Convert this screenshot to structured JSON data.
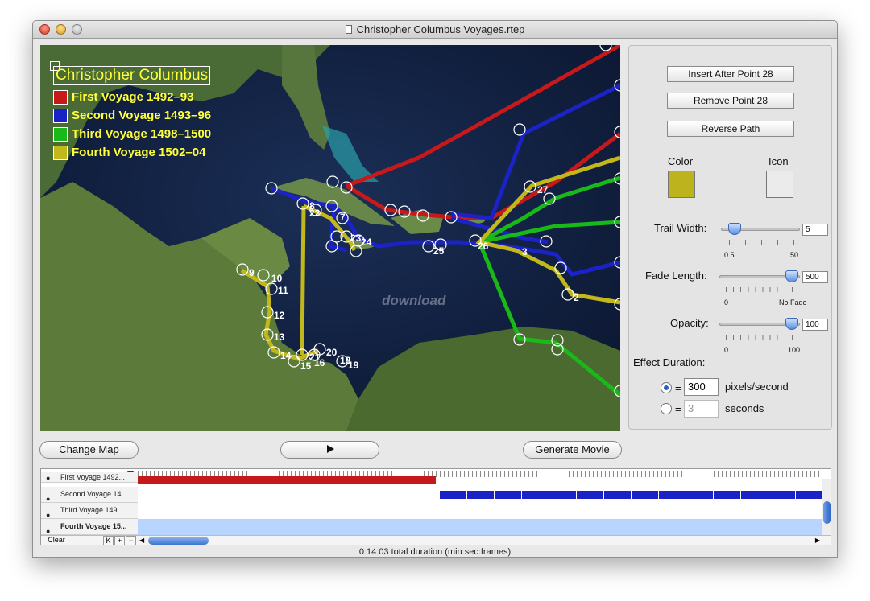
{
  "window": {
    "title": "Christopher Columbus Voyages.rtep"
  },
  "map": {
    "legend_title": "Christopher Columbus",
    "voyages": [
      {
        "label": "First Voyage 1492–93",
        "color": "#c8191a"
      },
      {
        "label": "Second Voyage 1493–96",
        "color": "#1a22c8"
      },
      {
        "label": "Third Voyage 1498–1500",
        "color": "#18b918"
      },
      {
        "label": "Fourth Voyage 1502–04",
        "color": "#c2b81c"
      }
    ],
    "point_labels": [
      "27",
      "8",
      "22",
      "7",
      "23",
      "24",
      "25",
      "26",
      "3",
      "2",
      "9",
      "10",
      "11",
      "12",
      "13",
      "14",
      "15",
      "21",
      "16",
      "20",
      "18",
      "19"
    ],
    "watermark": "download"
  },
  "panel": {
    "insert_button": "Insert After Point 28",
    "remove_button": "Remove Point 28",
    "reverse_button": "Reverse Path",
    "color_label": "Color",
    "icon_label": "Icon",
    "selected_color": "#bdb31c",
    "trail_width": {
      "label": "Trail Width:",
      "value": "5",
      "fraction": 0.18,
      "ticks": [
        "0 5",
        "50"
      ]
    },
    "fade_length": {
      "label": "Fade Length:",
      "value": "500",
      "fraction": 0.9,
      "ticks": [
        "0",
        "No Fade"
      ]
    },
    "opacity": {
      "label": "Opacity:",
      "value": "100",
      "fraction": 0.9,
      "ticks": [
        "0",
        "100"
      ]
    },
    "effect_duration_label": "Effect Duration:",
    "option_pixels": {
      "eq": "=",
      "value": "300",
      "unit": "pixels/second",
      "selected": true
    },
    "option_seconds": {
      "eq": "=",
      "value": "3",
      "unit": "seconds",
      "selected": false
    }
  },
  "controls": {
    "change_map": "Change Map",
    "play_icon": "play-icon",
    "generate_movie": "Generate Movie"
  },
  "timeline": {
    "tracks": [
      {
        "name": "First Voyage 1492..."
      },
      {
        "name": "Second Voyage 14..."
      },
      {
        "name": "Third Voyage 149..."
      },
      {
        "name": "Fourth Voyage 15..."
      }
    ],
    "clear_label": "Clear",
    "k_label": "K",
    "plus_label": "+",
    "minus_label": "−"
  },
  "status": "0:14:03 total duration (min:sec:frames)"
}
